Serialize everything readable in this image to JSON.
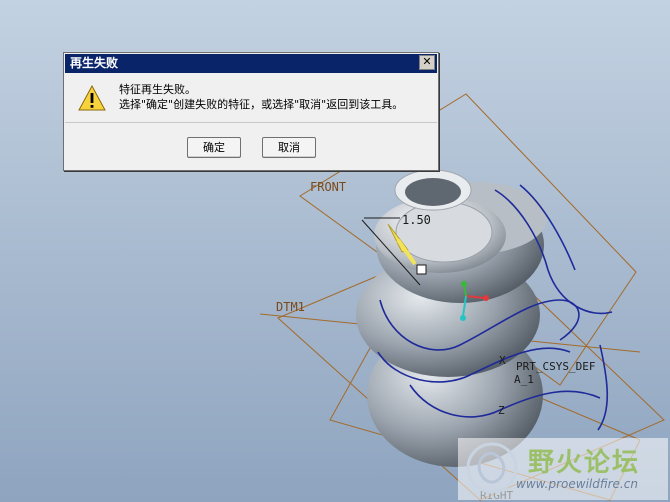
{
  "dialog": {
    "title": "再生失败",
    "close_glyph": "✕",
    "icon": "warning-icon",
    "message_line1": "特征再生失败。",
    "message_line2": "选择\"确定\"创建失败的特征，或选择\"取消\"返回到该工具。",
    "ok_label": "确定",
    "cancel_label": "取消"
  },
  "viewport": {
    "datum_labels": {
      "front": "FRONT",
      "dtm1": "DTM1",
      "csys": "PRT_CSYS_DEF",
      "a1": "A_1",
      "right": "RIGHT",
      "axis_x": "X",
      "axis_z": "Z"
    },
    "dimension": "1.50",
    "colors": {
      "datum_plane": "#a36a2a",
      "curve": "#1e2a9a",
      "dimension_arrow": "#f2e35a",
      "csys_x": "#e03a3a",
      "csys_y": "#3ab83a",
      "csys_z": "#25c4c4"
    }
  },
  "watermark": {
    "logo_text": "野火论坛",
    "url": "www.proewildfire.cn"
  }
}
